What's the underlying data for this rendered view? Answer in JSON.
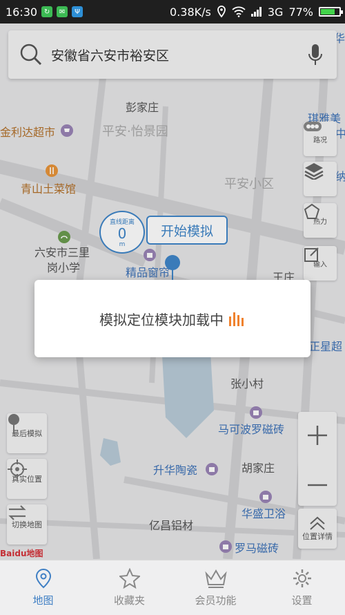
{
  "status_bar": {
    "time": "16:30",
    "network_speed": "0.38K/s",
    "network_type": "3G",
    "battery": "77%",
    "battery_level": 0.77
  },
  "search": {
    "text": "安徽省六安市裕安区"
  },
  "map": {
    "labels": {
      "pengjiazhuang": "彭家庄",
      "pingan_yijingyuan": "平安·怡景园",
      "jinlida": "金利达超市",
      "qingshan": "青山土菜馆",
      "pingan_xiaoqu": "平安小区",
      "school_line1": "六安市三里",
      "school_line2": "岗小学",
      "jingpin": "精品窗帘",
      "wangzhuang": "王庄",
      "zhangxiaocun": "张小村",
      "makebolo": "马可波罗磁砖",
      "huajiazhuang": "胡家庄",
      "shenghua": "升华陶瓷",
      "huasheng": "华盛卫浴",
      "yichang": "亿昌铝材",
      "luoma": "罗马磁砖",
      "zhengxing": "正星超",
      "qiya": "琪雅美",
      "hua": "华",
      "zhong": "中",
      "na": "纳"
    },
    "baidu_logo": "Baidu地图"
  },
  "simulation": {
    "distance_label": "直线距离",
    "distance_value": "0",
    "distance_unit": "m",
    "start_button": "开始模拟"
  },
  "right_tools": {
    "traffic": "路况",
    "layers": "",
    "heatmap": "热力",
    "input": "输入",
    "location_detail": "位置详情"
  },
  "left_tools": {
    "last_sim": "最后模拟",
    "real_location": "真实位置",
    "switch_map": "切换地图"
  },
  "modal": {
    "message": "模拟定位模块加载中"
  },
  "tabs": [
    {
      "label": "地图",
      "active": true
    },
    {
      "label": "收藏夹",
      "active": false
    },
    {
      "label": "会员功能",
      "active": false
    },
    {
      "label": "设置",
      "active": false
    }
  ],
  "colors": {
    "accent": "#3f7fc4",
    "loading_bars": "#f0822e",
    "battery_fill": "#42d34a"
  }
}
